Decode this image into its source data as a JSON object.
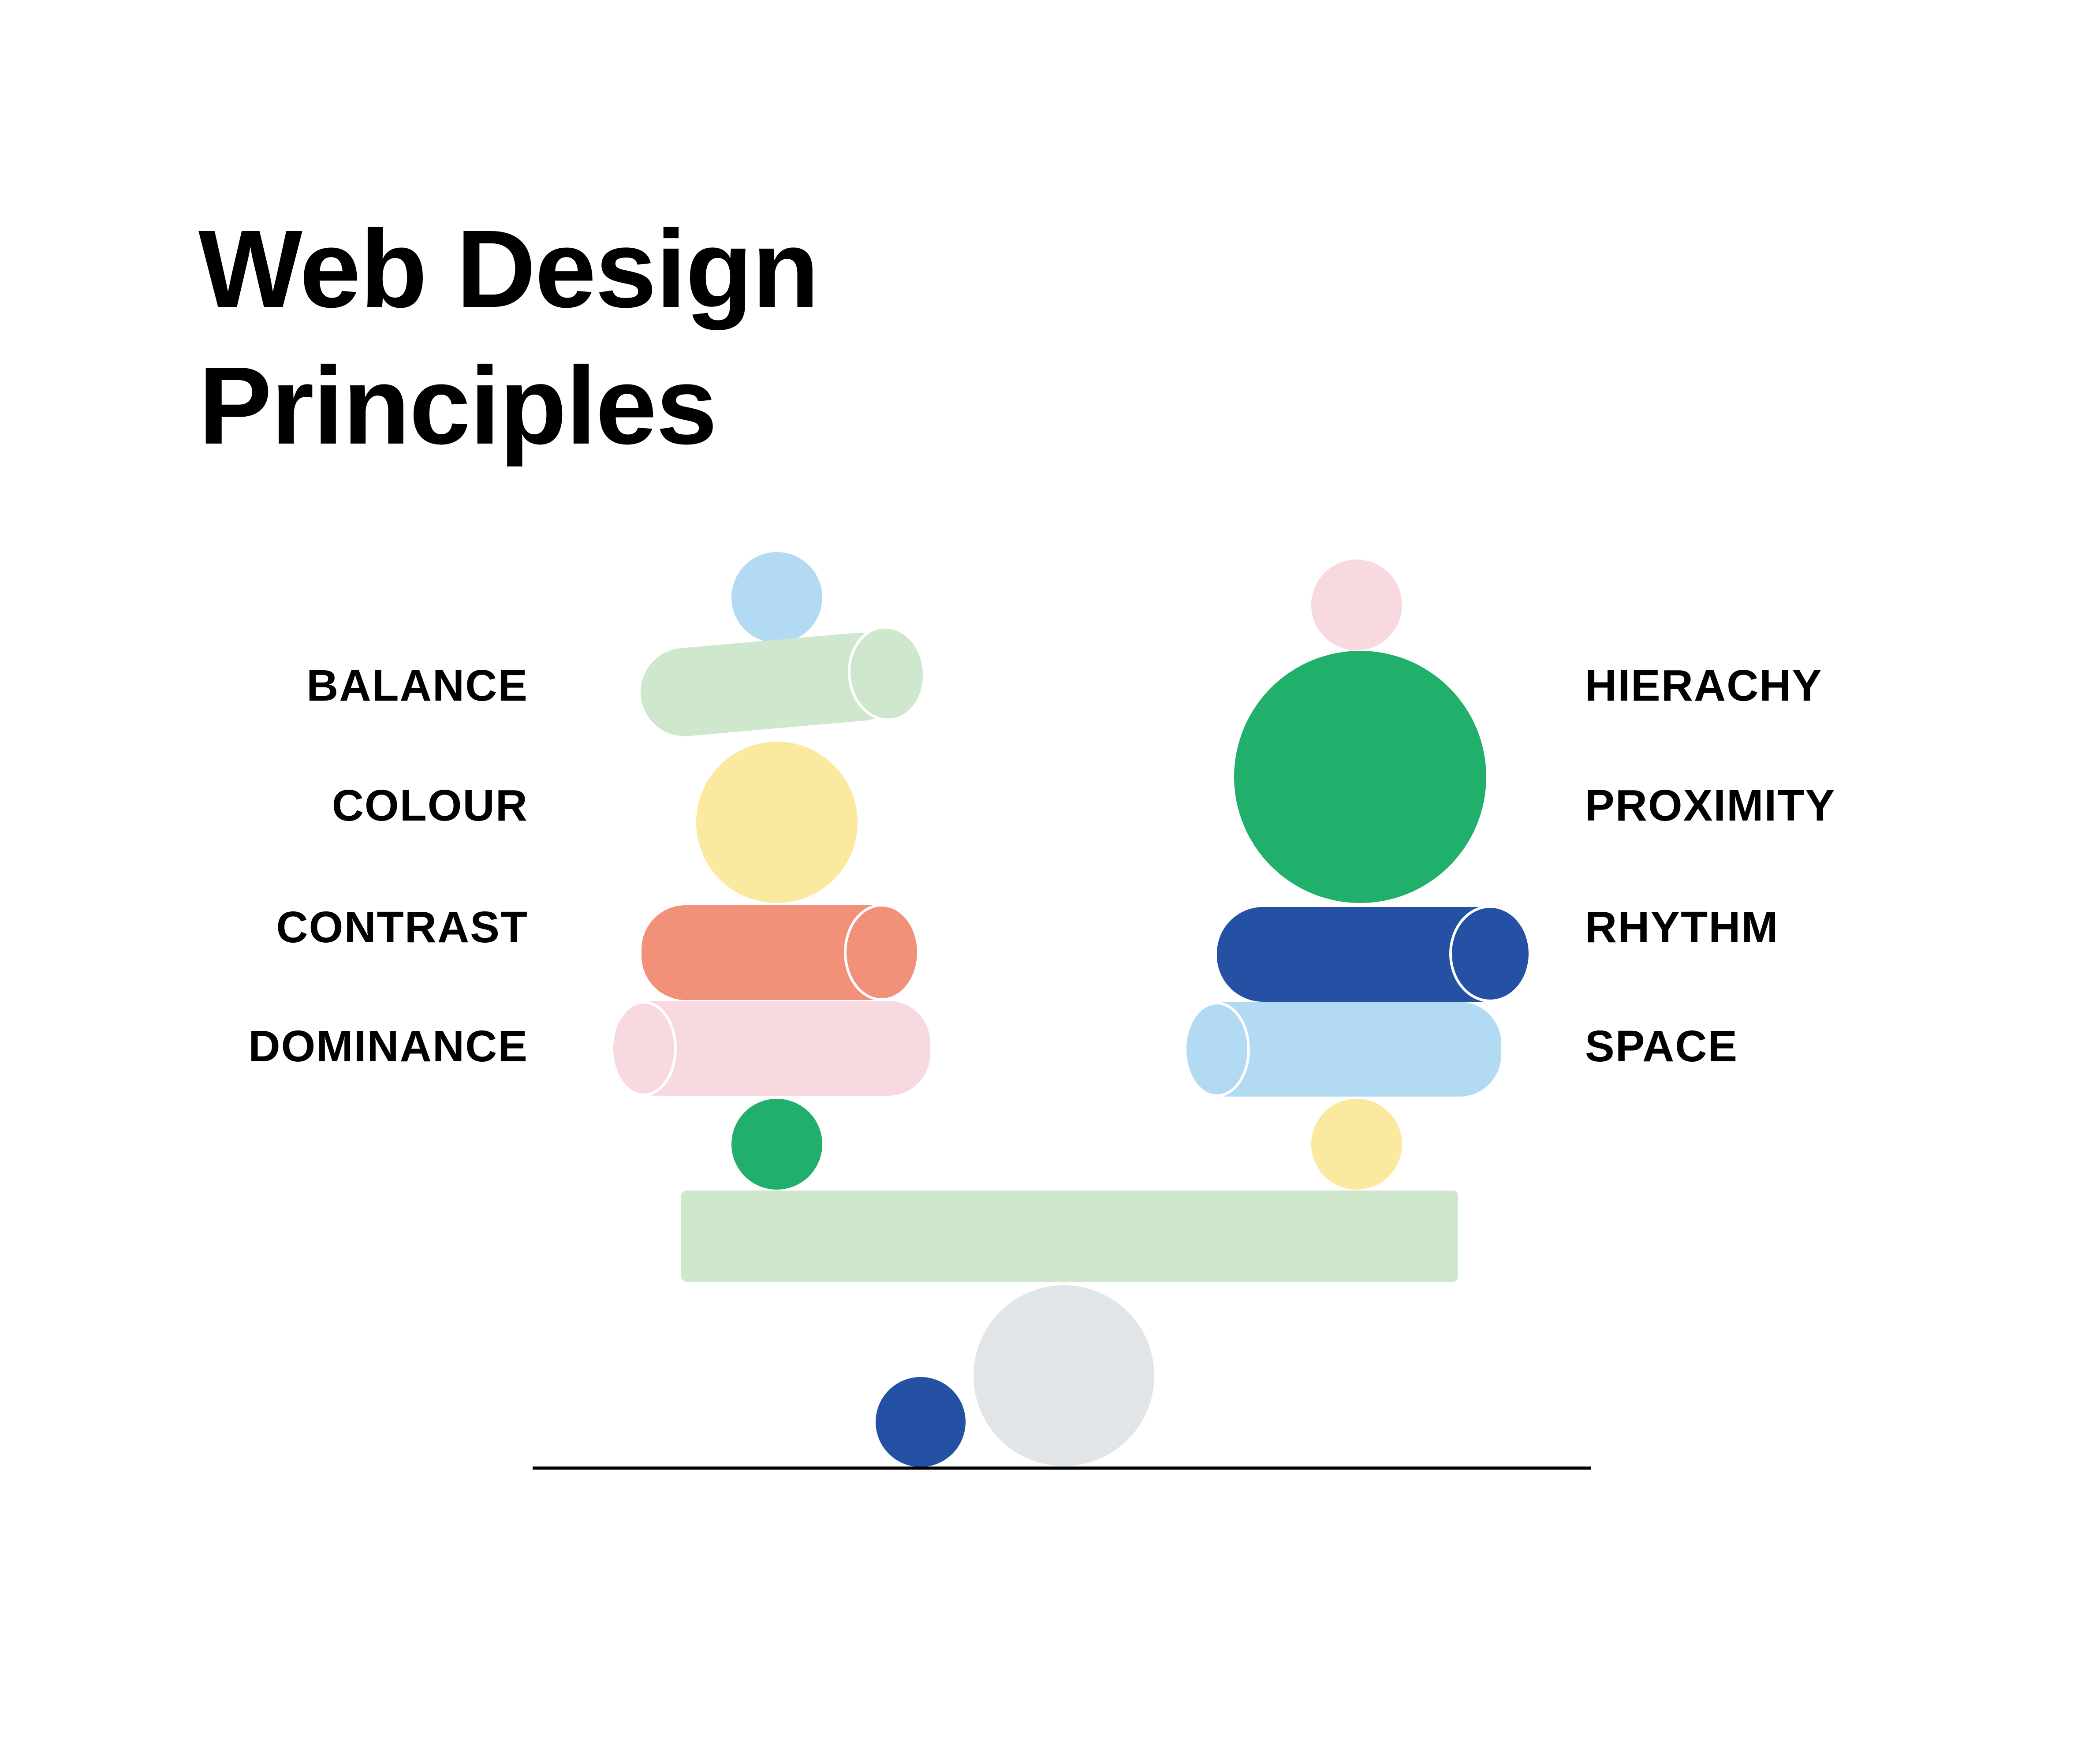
{
  "title": {
    "line1": "Web Design",
    "line2": "Principles"
  },
  "left_labels": [
    "BALANCE",
    "COLOUR",
    "CONTRAST",
    "DOMINANCE"
  ],
  "right_labels": [
    "HIERACHY",
    "PROXIMITY",
    "RHYTHM",
    "SPACE"
  ],
  "colors": {
    "light_green": "#cfe7cc",
    "light_blue": "#b2daf3",
    "yellow": "#fbe9a0",
    "salmon": "#f2917a",
    "pink": "#f9d9e0",
    "green": "#20b06b",
    "navy": "#2451a4",
    "gray": "#e2e5e8",
    "ground": "#000000"
  }
}
